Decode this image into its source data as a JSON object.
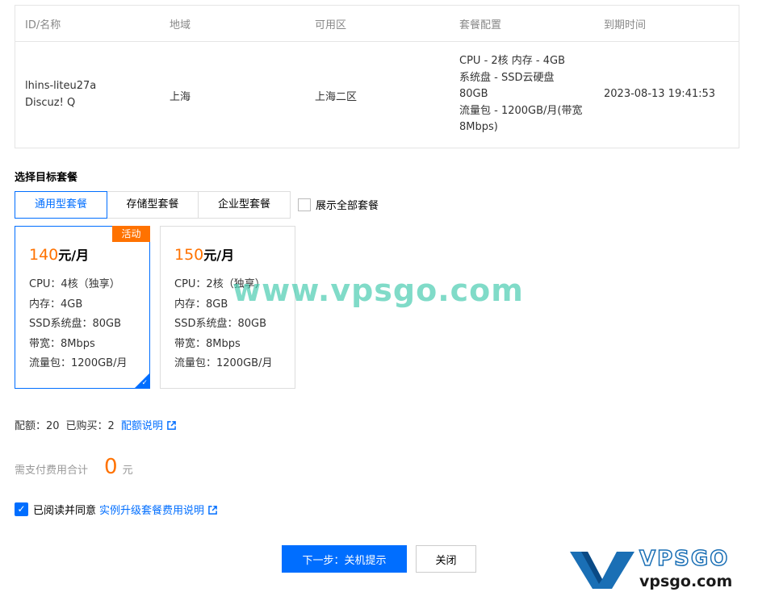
{
  "table": {
    "headers": [
      "ID/名称",
      "地域",
      "可用区",
      "套餐配置",
      "到期时间"
    ],
    "row": {
      "id": "lhins-liteu27a",
      "name": "Discuz! Q",
      "region": "上海",
      "zone": "上海二区",
      "spec_lines": [
        "CPU - 2核 内存 - 4GB",
        "系统盘 - SSD云硬盘",
        "80GB",
        "流量包 - 1200GB/月(带宽",
        "8Mbps)"
      ],
      "expire": "2023-08-13 19:41:53"
    }
  },
  "section_title": "选择目标套餐",
  "tabs": [
    {
      "label": "通用型套餐",
      "active": true
    },
    {
      "label": "存储型套餐",
      "active": false
    },
    {
      "label": "企业型套餐",
      "active": false
    }
  ],
  "show_all_label": "展示全部套餐",
  "cards": [
    {
      "price": "140",
      "unit": "元/月",
      "badge": "活动",
      "selected": true,
      "specs": [
        "CPU：4核（独享）",
        "内存：4GB",
        "SSD系统盘：80GB",
        "带宽：8Mbps",
        "流量包：1200GB/月"
      ]
    },
    {
      "price": "150",
      "unit": "元/月",
      "selected": false,
      "specs": [
        "CPU：2核（独享）",
        "内存：8GB",
        "SSD系统盘：80GB",
        "带宽：8Mbps",
        "流量包：1200GB/月"
      ]
    }
  ],
  "watermark": "www.vpsgo.com",
  "quota": {
    "quota_label": "配额：20",
    "purchased_label": "已购买：2",
    "link": "配额说明"
  },
  "total": {
    "label": "需支付费用合计",
    "amount": "0",
    "unit": "元"
  },
  "agree": {
    "label": "已阅读并同意",
    "link": "实例升级套餐费用说明",
    "checked": true
  },
  "buttons": {
    "next": "下一步：关机提示",
    "close": "关闭"
  },
  "logo": {
    "text_top": "VPSGO",
    "text_bottom": "vpsgo.com"
  },
  "colors": {
    "accent": "#006eff",
    "price": "#ff7200",
    "badge": "#ff7200"
  }
}
